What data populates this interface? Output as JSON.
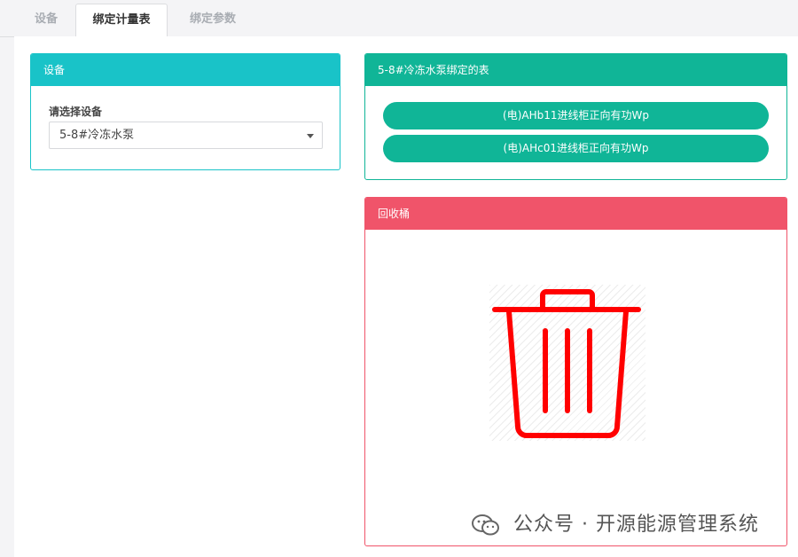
{
  "tabs": [
    {
      "label": "设备"
    },
    {
      "label": "绑定计量表",
      "active": true
    },
    {
      "label": "绑定参数"
    }
  ],
  "device_panel": {
    "title": "设备",
    "select_label": "请选择设备",
    "selected_device": "5-8#冷冻水泵"
  },
  "bound_panel": {
    "title": "5-8#冷冻水泵绑定的表",
    "meters": [
      {
        "label": "(电)AHb11进线柜正向有功Wp"
      },
      {
        "label": "(电)AHc01进线柜正向有功Wp"
      }
    ]
  },
  "recycle_panel": {
    "title": "回收桶",
    "icon": "trash-icon"
  },
  "watermark": {
    "text": "公众号 · 开源能源管理系统",
    "icon": "wechat-icon"
  },
  "colors": {
    "device_header": "#19c3c8",
    "bound_header": "#10b597",
    "recycle_header": "#f0546a",
    "trash_icon": "#ff0000"
  }
}
